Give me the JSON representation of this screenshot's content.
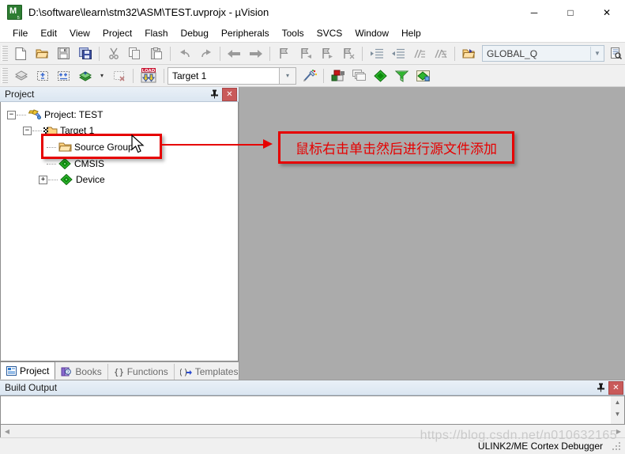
{
  "window": {
    "title": "D:\\software\\learn\\stm32\\ASM\\TEST.uvprojx - µVision",
    "app_icon": "uvision-icon",
    "controls": {
      "minimize": "─",
      "maximize": "□",
      "close": "✕"
    }
  },
  "menubar": {
    "items": [
      {
        "label": "File"
      },
      {
        "label": "Edit"
      },
      {
        "label": "View"
      },
      {
        "label": "Project"
      },
      {
        "label": "Flash"
      },
      {
        "label": "Debug"
      },
      {
        "label": "Peripherals"
      },
      {
        "label": "Tools"
      },
      {
        "label": "SVCS"
      },
      {
        "label": "Window"
      },
      {
        "label": "Help"
      }
    ]
  },
  "toolbar_main": {
    "buttons": [
      {
        "name": "new-file-icon"
      },
      {
        "name": "open-file-icon"
      },
      {
        "name": "save-icon"
      },
      {
        "name": "save-all-icon"
      },
      {
        "name": "cut-icon"
      },
      {
        "name": "copy-icon"
      },
      {
        "name": "paste-icon"
      },
      {
        "name": "undo-icon"
      },
      {
        "name": "redo-icon"
      },
      {
        "name": "navigate-back-icon"
      },
      {
        "name": "navigate-forward-icon"
      },
      {
        "name": "bookmark-toggle-icon"
      },
      {
        "name": "bookmark-prev-icon"
      },
      {
        "name": "bookmark-next-icon"
      },
      {
        "name": "bookmark-clear-icon"
      },
      {
        "name": "indent-icon"
      },
      {
        "name": "outdent-icon"
      },
      {
        "name": "comment-icon"
      },
      {
        "name": "uncomment-icon"
      },
      {
        "name": "open-find-file-icon"
      }
    ],
    "search_combo": {
      "value": "GLOBAL_Q",
      "placeholder": "GLOBAL_Q",
      "arrow": "▼"
    },
    "after_combo": [
      {
        "name": "find-in-files-icon"
      },
      {
        "name": "incremental-find-icon"
      },
      {
        "name": "debug-stop-icon"
      }
    ],
    "dropdown_arrow": "▾"
  },
  "toolbar_build": {
    "buttons": [
      {
        "name": "translate-file-icon"
      },
      {
        "name": "build-target-icon"
      },
      {
        "name": "rebuild-all-icon"
      },
      {
        "name": "batch-build-icon"
      },
      {
        "name": "stop-build-icon"
      },
      {
        "name": "download-icon"
      }
    ],
    "batch_arrow": "▾",
    "target_select": {
      "value": "Target 1",
      "arrow": "▾"
    },
    "right_buttons": [
      {
        "name": "target-options-icon"
      },
      {
        "name": "manage-components-icon"
      },
      {
        "name": "manage-windows-icon"
      },
      {
        "name": "pack-installer-icon"
      },
      {
        "name": "configure-filter-icon"
      },
      {
        "name": "multi-project-icon"
      }
    ]
  },
  "project_panel": {
    "title": "Project",
    "pin_icon": "pin-icon",
    "close_icon": "close-icon",
    "tree": [
      {
        "label": "Project: TEST",
        "icon": "project-icon",
        "expander": "−",
        "depth": 0
      },
      {
        "label": "Target 1",
        "icon": "target-icon",
        "expander": "−",
        "depth": 1
      },
      {
        "label": "Source Group 1",
        "icon": "folder-icon",
        "expander": "",
        "depth": 2,
        "highlighted": true
      },
      {
        "label": "CMSIS",
        "icon": "component-icon",
        "expander": "",
        "depth": 2
      },
      {
        "label": "Device",
        "icon": "component-icon",
        "expander": "+",
        "depth": 2
      }
    ],
    "tabs": [
      {
        "label": "Project",
        "icon": "project-tab-icon",
        "active": true
      },
      {
        "label": "Books",
        "icon": "books-tab-icon",
        "active": false
      },
      {
        "label": "Functions",
        "icon": "functions-tab-icon",
        "active": false
      },
      {
        "label": "Templates",
        "icon": "templates-tab-icon",
        "active": false
      }
    ]
  },
  "build_output": {
    "title": "Build Output",
    "pin_icon": "pin-icon",
    "close_icon": "close-icon",
    "content": "",
    "scroll_up": "▲",
    "scroll_down": "▼",
    "scroll_left": "◀",
    "scroll_right": "▶"
  },
  "annotation": {
    "text": "鼠标右击单击然后进行源文件添加",
    "color": "#e60000",
    "target": "Source Group 1"
  },
  "statusbar": {
    "debugger": "ULINK2/ME Cortex Debugger",
    "watermark": "https://blog.csdn.net/n010632165"
  },
  "colors": {
    "editor_background": "#ababab",
    "panel_title": "#dbe6f1",
    "annotation_red": "#e60000",
    "close_red": "#c95a5a"
  }
}
